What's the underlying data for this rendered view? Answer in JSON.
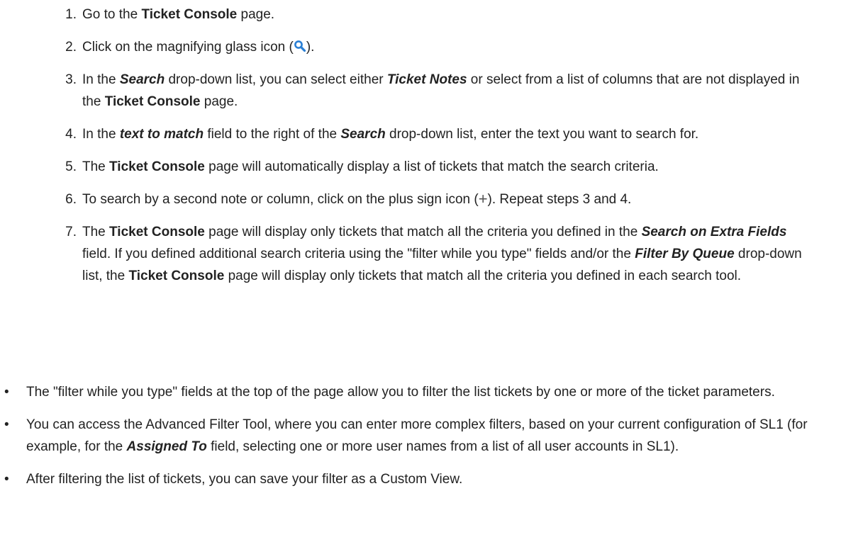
{
  "steps": [
    {
      "num": "1.",
      "parts": {
        "a": "Go to the ",
        "b": "Ticket Console",
        "c": " page."
      }
    },
    {
      "num": "2.",
      "parts": {
        "a": "Click on the magnifying glass icon (",
        "c": ")."
      }
    },
    {
      "num": "3.",
      "parts": {
        "a": "In the ",
        "b": "Search",
        "c": " drop-down list, you can select either ",
        "d": "Ticket Notes",
        "e": " or select from a list of columns that are not displayed in the ",
        "f": "Ticket Console",
        "g": " page."
      }
    },
    {
      "num": "4.",
      "parts": {
        "a": "In the ",
        "b": "text to match",
        "c": " field to the right of the ",
        "d": "Search",
        "e": " drop-down list, enter the text you want to search for."
      }
    },
    {
      "num": "5.",
      "parts": {
        "a": "The ",
        "b": "Ticket Console",
        "c": " page will automatically display a list of tickets that match the search criteria."
      }
    },
    {
      "num": "6.",
      "parts": {
        "a": "To search by a second note or column, click on the plus sign icon (",
        "plus": "+",
        "c": "). Repeat steps 3 and 4."
      }
    },
    {
      "num": "7.",
      "parts": {
        "a": "The ",
        "b": "Ticket Console",
        "c": " page will display only tickets that match all the criteria you defined in the ",
        "d": "Search on Extra Fields",
        "e": " field. If you defined additional search criteria using the \"filter while you type\" fields and/or the ",
        "f": "Filter By Queue",
        "g": " drop-down list, the ",
        "h": "Ticket Console",
        "i": " page will display only tickets that match all the criteria you defined in each search tool."
      }
    }
  ],
  "bullets": [
    {
      "marker": "•",
      "parts": {
        "a": "The \"filter while you type\" fields at the top of the page allow you to filter the list tickets by one or more of the ticket parameters."
      }
    },
    {
      "marker": "•",
      "parts": {
        "a": "You can access the Advanced Filter Tool, where you can enter more complex filters, based on your current configuration of SL1 (for example, for the ",
        "b": "Assigned To",
        "c": " field, selecting one or more user names from a list of all user accounts in SL1)."
      }
    },
    {
      "marker": "•",
      "parts": {
        "a": "After filtering the list of tickets, you can save your filter as a Custom View."
      }
    }
  ],
  "icons": {
    "magnifier": "magnifying-glass-icon",
    "plus": "plus-sign-icon",
    "magnifier_color": "#2a7fd4"
  }
}
